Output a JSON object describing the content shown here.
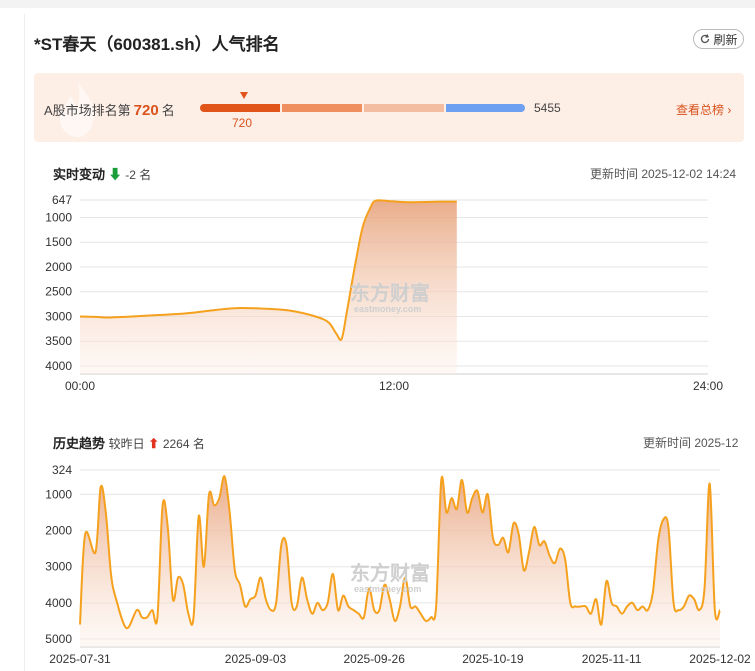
{
  "page": {
    "title": "*ST春天（600381.sh）人气排名",
    "refresh_label": "刷新"
  },
  "rank": {
    "prefix": "A股市场排名第",
    "value": "720",
    "suffix": "名",
    "marker_value": "720",
    "max_value": "5455",
    "marker_fraction": 0.132,
    "view_all_label": "查看总榜"
  },
  "realtime": {
    "title": "实时变动",
    "change": "-2 名",
    "update_text": "更新时间 2025-12-02 14:24",
    "watermark": "东方财富",
    "watermark_sub": "eastmoney.com"
  },
  "history": {
    "title": "历史趋势",
    "compare_label": "较昨日",
    "change": "2264 名",
    "update_text": "更新时间 2025-12",
    "watermark": "东方财富",
    "watermark_sub": "eastmoney.com"
  },
  "colors": {
    "accent": "#f5a11e",
    "fill_top": "#e9a884",
    "brand": "#d9531e"
  },
  "chart_data": [
    {
      "type": "area",
      "title": "实时变动",
      "y_inverted": true,
      "ylim": [
        647,
        4000
      ],
      "y_ticks": [
        "647",
        "1000",
        "1500",
        "2000",
        "2500",
        "3000",
        "3500",
        "4000"
      ],
      "y_tick_values": [
        647,
        1000,
        1500,
        2000,
        2500,
        3000,
        3500,
        4000
      ],
      "x_ticks": [
        "00:00",
        "12:00",
        "24:00"
      ],
      "x_tick_hours": [
        0,
        12,
        24
      ],
      "series": [
        {
          "hours": [
            0,
            0.7,
            1,
            2,
            3,
            4,
            5,
            5.5,
            6,
            7,
            8,
            9,
            9.5,
            9.8,
            10,
            10.2,
            10.5,
            10.8,
            11.1,
            11.3,
            11.8,
            12.4,
            13,
            13.8,
            14.4
          ],
          "values": [
            3000,
            3010,
            3020,
            3000,
            2970,
            2940,
            2880,
            2850,
            2830,
            2840,
            2880,
            3000,
            3120,
            3350,
            3450,
            2900,
            2000,
            1200,
            800,
            660,
            670,
            690,
            690,
            680,
            680
          ]
        }
      ]
    },
    {
      "type": "area",
      "title": "历史趋势",
      "y_inverted": true,
      "ylim": [
        324,
        5000
      ],
      "y_ticks": [
        "324",
        "1000",
        "2000",
        "3000",
        "4000",
        "5000"
      ],
      "y_tick_values": [
        324,
        1000,
        2000,
        3000,
        4000,
        5000
      ],
      "x_ticks": [
        "2025-07-31",
        "2025-09-03",
        "2025-09-26",
        "2025-10-19",
        "2025-11-11",
        "2025-12-02"
      ],
      "x_tick_days": [
        0,
        34,
        57,
        80,
        103,
        124
      ],
      "series": [
        {
          "days": [
            0,
            1,
            3,
            4,
            5,
            6,
            7,
            9,
            11,
            12,
            13,
            14,
            15,
            16,
            17,
            18,
            19,
            20,
            21,
            22,
            23,
            24,
            25,
            26,
            27,
            28,
            29,
            30,
            31,
            32,
            33,
            34,
            35,
            36,
            37,
            38,
            39,
            40,
            41,
            42,
            43,
            44,
            45,
            46,
            47,
            48,
            49,
            50,
            51,
            52,
            53,
            54,
            55,
            56,
            57,
            58,
            59,
            60,
            61,
            62,
            63,
            64,
            65,
            66,
            67,
            68,
            69,
            70,
            71,
            72,
            73,
            74,
            75,
            76,
            77,
            78,
            79,
            80,
            81,
            82,
            83,
            84,
            85,
            86,
            87,
            88,
            89,
            90,
            91,
            92,
            93,
            94,
            95,
            96,
            97,
            98,
            99,
            100,
            101,
            102,
            103,
            104,
            105,
            106,
            107,
            108,
            109,
            110,
            111,
            112,
            113,
            114,
            115,
            116,
            117,
            118,
            119,
            120,
            121,
            122,
            123,
            124
          ],
          "values": [
            4600,
            2100,
            2600,
            800,
            1500,
            3200,
            3900,
            4700,
            4200,
            4400,
            4400,
            4200,
            4400,
            1300,
            1900,
            3900,
            3300,
            3500,
            4300,
            4400,
            1600,
            3000,
            1000,
            1300,
            1100,
            500,
            1500,
            3100,
            3500,
            4100,
            3900,
            3800,
            3300,
            3900,
            4200,
            4000,
            2400,
            2400,
            4000,
            4100,
            3300,
            3900,
            4300,
            4000,
            4200,
            4000,
            3200,
            4200,
            3800,
            4100,
            4200,
            4300,
            4400,
            3600,
            4200,
            4200,
            3500,
            3900,
            4500,
            4100,
            3300,
            4100,
            4100,
            4300,
            4500,
            4400,
            4100,
            600,
            1500,
            1100,
            1400,
            600,
            1500,
            1100,
            900,
            1500,
            1000,
            2200,
            2400,
            2200,
            2600,
            1800,
            2100,
            3100,
            2600,
            1900,
            2400,
            2300,
            2700,
            2900,
            2500,
            2800,
            4000,
            4100,
            4100,
            4100,
            4300,
            3900,
            4600,
            3400,
            4000,
            4100,
            4300,
            4100,
            4000,
            4200,
            4100,
            4200,
            3700,
            2300,
            1700,
            1900,
            4000,
            4200,
            4100,
            3800,
            3900,
            4200,
            3600,
            700,
            4200,
            4200
          ]
        }
      ]
    }
  ]
}
